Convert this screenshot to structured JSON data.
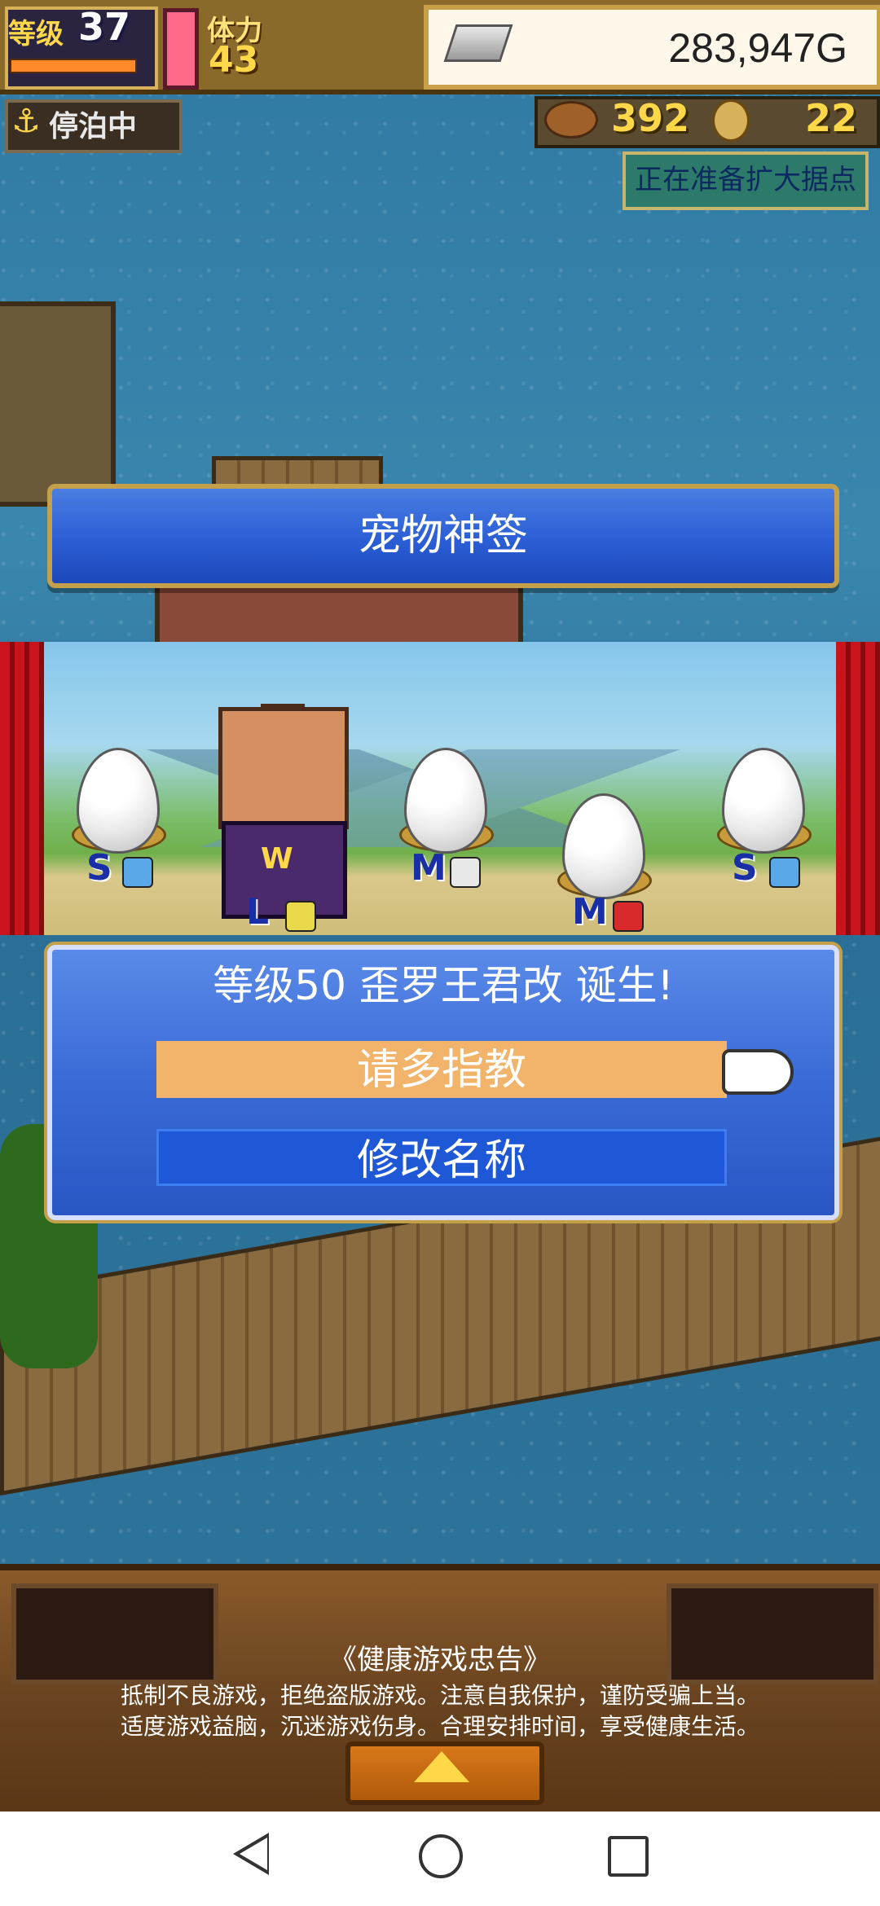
{
  "hud": {
    "level_label": "等级",
    "level_value": "37",
    "stamina_label": "体力",
    "stamina_value": "43",
    "money_value": "283,947G",
    "status_badge": "停泊中",
    "wood_count": "392",
    "coin_count": "22",
    "notice": "正在准备扩大据点"
  },
  "banner": {
    "title": "宠物神签"
  },
  "stage": {
    "eggs": [
      {
        "size": "S"
      },
      {
        "size": "M"
      },
      {
        "size": "M"
      },
      {
        "size": "S"
      }
    ],
    "character_size": "L",
    "character_emblem": "W"
  },
  "result": {
    "message": "等级50 歪罗王君改 诞生!",
    "accept_label": "请多指教",
    "rename_label": "修改名称"
  },
  "footer": {
    "notice_title": "《健康游戏忠告》",
    "notice_line1": "抵制不良游戏，拒绝盗版游戏。注意自我保护，谨防受骗上当。",
    "notice_line2": "适度游戏益脑，沉迷游戏伤身。合理安排时间，享受健康生活。"
  },
  "colors": {
    "accent_blue": "#2b5ed6",
    "accept_orange": "#f2b46a",
    "curtain_red": "#c8141a"
  },
  "icons": {
    "anchor": "anchor-icon",
    "money": "silver-bar-icon",
    "wood": "wood-icon",
    "coin": "coin-icon",
    "pointer": "pointing-hand-icon"
  }
}
